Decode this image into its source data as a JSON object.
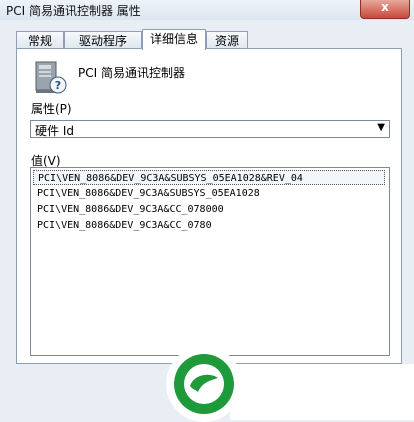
{
  "window": {
    "title": "PCI 简易通讯控制器 属性",
    "close_label": "x"
  },
  "tabs": [
    {
      "label": "常规",
      "active": false
    },
    {
      "label": "驱动程序",
      "active": false
    },
    {
      "label": "详细信息",
      "active": true
    },
    {
      "label": "资源",
      "active": false
    }
  ],
  "device": {
    "name": "PCI 简易通讯控制器",
    "icon": "pci-device-question-icon"
  },
  "property": {
    "label": "属性(P)",
    "selected": "硬件 Id"
  },
  "value": {
    "label": "值(V)",
    "items": [
      "PCI\\VEN_8086&DEV_9C3A&SUBSYS_05EA1028&REV_04",
      "PCI\\VEN_8086&DEV_9C3A&SUBSYS_05EA1028",
      "PCI\\VEN_8086&DEV_9C3A&CC_078000",
      "PCI\\VEN_8086&DEV_9C3A&CC_0780"
    ]
  },
  "watermark": {
    "icon": "green-leaf-logo"
  }
}
